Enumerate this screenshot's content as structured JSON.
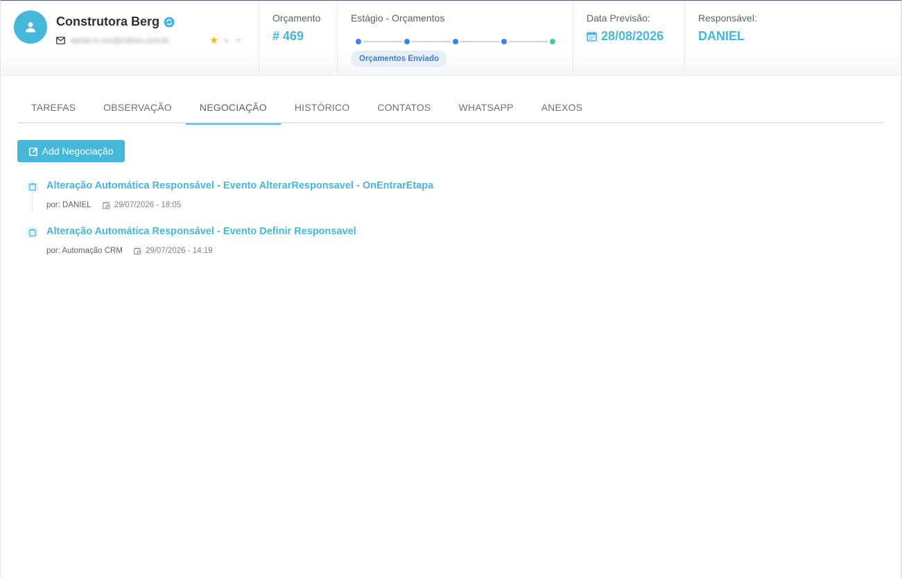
{
  "client": {
    "name": "Construtora Berg",
    "email": "daniel.m.xxx@cobrex.com.br",
    "rating": 1,
    "rating_max": 3,
    "icons": {
      "avatar": "user-avatar-icon",
      "verified": "sync-badge-icon",
      "email": "mail-icon"
    }
  },
  "budget": {
    "label": "Orçamento",
    "value": "# 469"
  },
  "stage": {
    "label": "Estágio - Orçamentos",
    "badge": "Orçamentos Enviado",
    "steps": [
      {
        "status": "done",
        "color": "#3b82f6"
      },
      {
        "status": "done",
        "color": "#3b82f6"
      },
      {
        "status": "done",
        "color": "#3b82f6"
      },
      {
        "status": "done",
        "color": "#3b82f6"
      },
      {
        "status": "current",
        "color": "#3ecf8e"
      }
    ]
  },
  "forecast": {
    "label": "Data Previsão:",
    "value": "28/08/2026",
    "icon": "calendar-icon"
  },
  "owner": {
    "label": "Responsável:",
    "value": "DANIEL"
  },
  "tabs": [
    {
      "label": "TAREFAS",
      "active": false
    },
    {
      "label": "OBSERVAÇÃO",
      "active": false
    },
    {
      "label": "NEGOCIAÇÃO",
      "active": true
    },
    {
      "label": "HISTÓRICO",
      "active": false
    },
    {
      "label": "CONTATOS",
      "active": false
    },
    {
      "label": "WHATSAPP",
      "active": false
    },
    {
      "label": "ANEXOS",
      "active": false
    }
  ],
  "add_button": {
    "label": "Add Negociação",
    "icon": "note-edit-icon"
  },
  "negotiations": [
    {
      "title": "Alteração Automática Responsável - Evento AlterarResponsavel - OnEntrarEtapa",
      "author": "por: DANIEL",
      "datetime": "29/07/2026 - 18:05",
      "icon": "clipboard-icon"
    },
    {
      "title": "Alteração Automática Responsável - Evento Definir Responsavel",
      "author": "por: Automação CRM",
      "datetime": "29/07/2026 - 14:19",
      "icon": "clipboard-icon"
    }
  ],
  "colors": {
    "accent": "#45b7db",
    "stage_done": "#3b82f6",
    "stage_current": "#3ecf8e",
    "star_on": "#f5b90a"
  }
}
